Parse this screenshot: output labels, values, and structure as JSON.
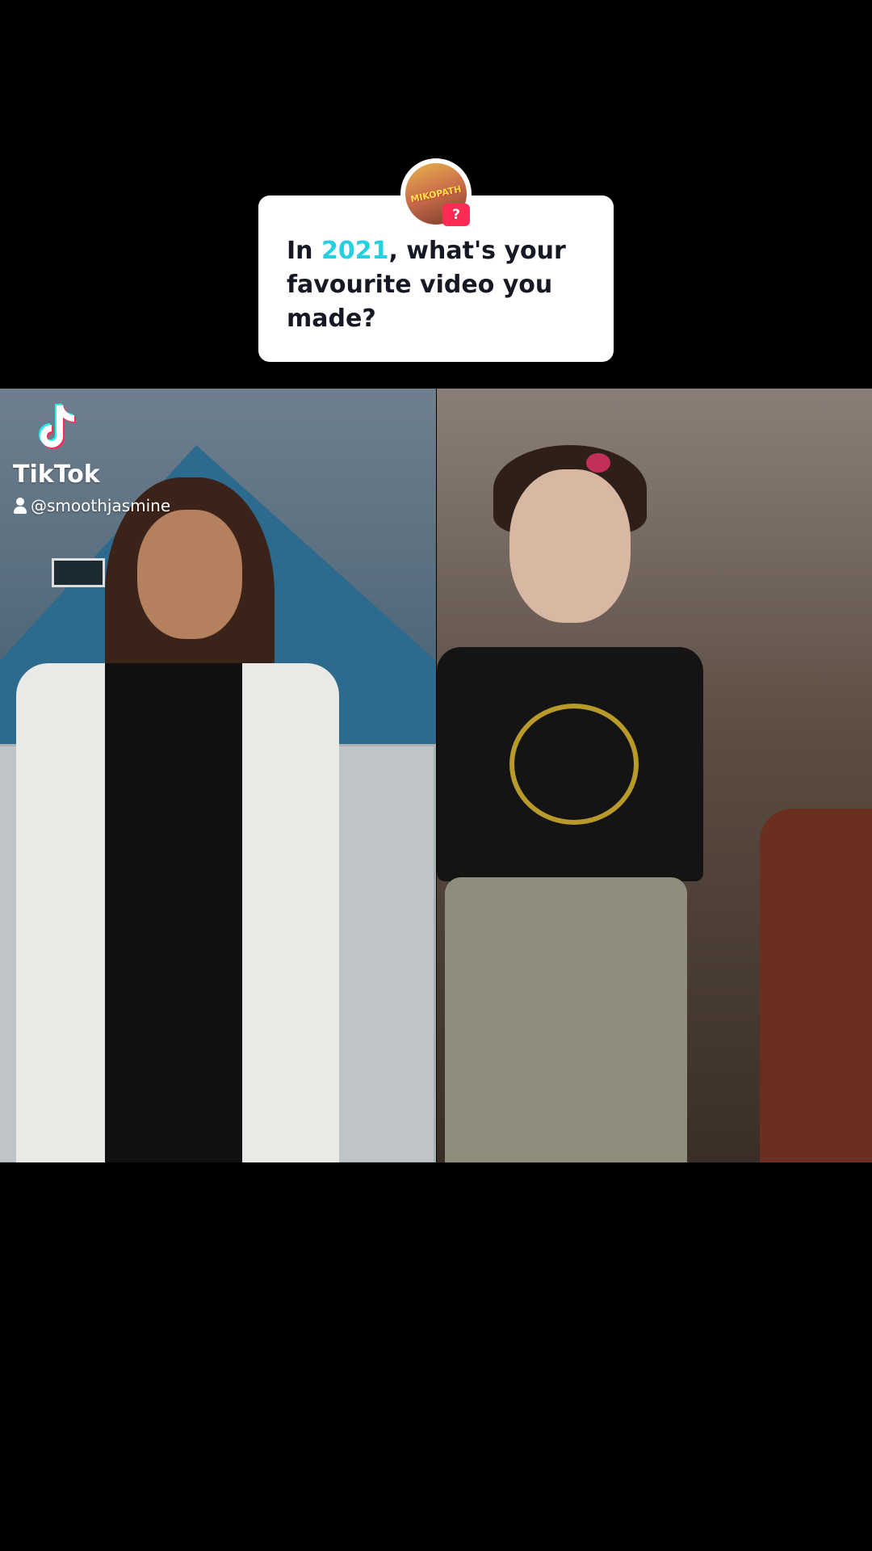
{
  "question": {
    "prefix": "In ",
    "highlight": "2021",
    "suffix": ", what's your favourite video you made?",
    "badge": "?",
    "avatar_text": "MIKOPATH"
  },
  "watermark": {
    "brand": "TikTok",
    "username": "@smoothjasmine",
    "logo_icon": "tiktok-note-icon"
  },
  "colors": {
    "highlight": "#25d0e0",
    "badge": "#fe2c55",
    "card_bg": "#ffffff"
  }
}
